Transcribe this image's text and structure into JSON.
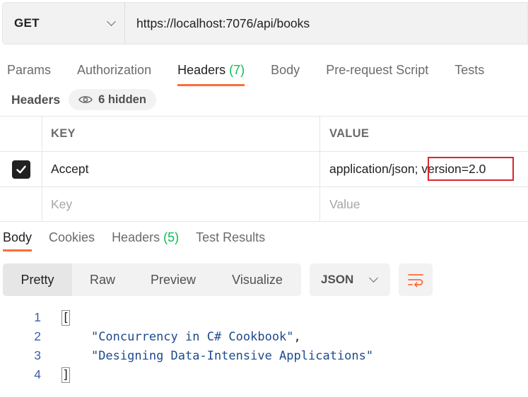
{
  "request": {
    "method": "GET",
    "url": "https://localhost:7076/api/books"
  },
  "request_tabs": [
    {
      "label": "Params"
    },
    {
      "label": "Authorization"
    },
    {
      "label": "Headers",
      "count": "(7)"
    },
    {
      "label": "Body"
    },
    {
      "label": "Pre-request Script"
    },
    {
      "label": "Tests"
    }
  ],
  "headers_section": {
    "title": "Headers",
    "hidden_label": "6 hidden"
  },
  "table": {
    "col_key": "KEY",
    "col_value": "VALUE",
    "rows": [
      {
        "checked": true,
        "key": "Accept",
        "value_part1": "application/json;",
        "value_part2": " version=2.0"
      }
    ],
    "placeholder_key": "Key",
    "placeholder_value": "Value"
  },
  "response_tabs": [
    {
      "label": "Body"
    },
    {
      "label": "Cookies"
    },
    {
      "label": "Headers",
      "count": "(5)"
    },
    {
      "label": "Test Results"
    }
  ],
  "view_modes": [
    "Pretty",
    "Raw",
    "Preview",
    "Visualize"
  ],
  "format": "JSON",
  "code": {
    "line_numbers": [
      "1",
      "2",
      "3",
      "4"
    ],
    "open_bracket": "[",
    "item1": "\"Concurrency in C# Cookbook\"",
    "comma": ",",
    "item2": "\"Designing Data-Intensive Applications\"",
    "close_bracket": "]"
  },
  "colors": {
    "accent": "#ff6c37",
    "count_green": "#0cbb52",
    "highlight_red": "#d7262f"
  }
}
